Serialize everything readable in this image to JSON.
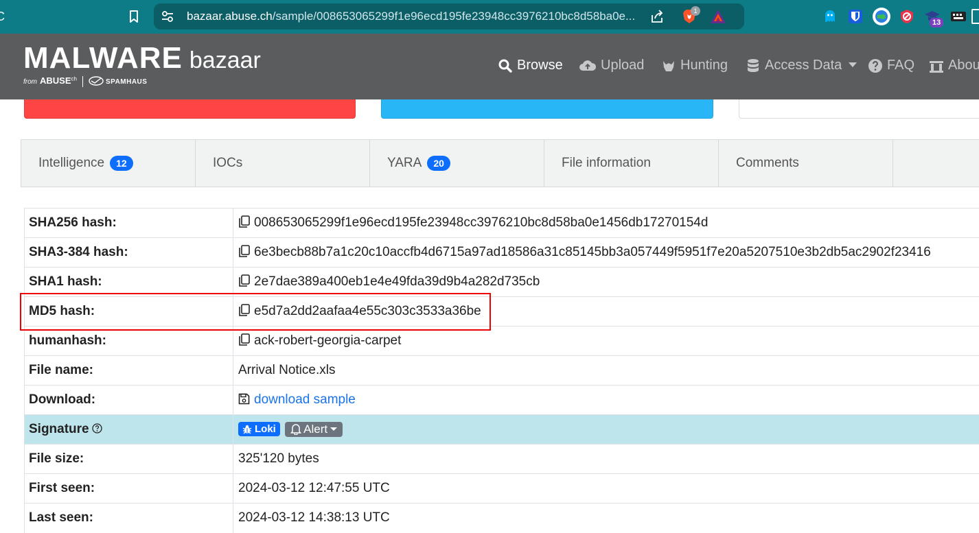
{
  "browser": {
    "url_host": "bazaar.abuse.ch",
    "url_path": "/sample/008653065299f1e96ecd195fe23948cc3976210bc8d58ba0e...",
    "brave_count": "1",
    "ext_badge_count": "13"
  },
  "header": {
    "logo_main": "MALWARE",
    "logo_suffix": "bazaar",
    "logo_from": "from",
    "logo_abuse": "ABUSE",
    "logo_ch": "ch",
    "logo_spamhaus": "SPAMHAUS",
    "nav": [
      {
        "label": "Browse",
        "icon": "search-icon",
        "active": true
      },
      {
        "label": "Upload",
        "icon": "cloud-upload-icon"
      },
      {
        "label": "Hunting",
        "icon": "hunting-icon"
      },
      {
        "label": "Access Data",
        "icon": "database-icon"
      },
      {
        "label": "FAQ",
        "icon": "question-circle-icon"
      },
      {
        "label": "Abou",
        "icon": "bank-icon"
      }
    ]
  },
  "tabs": [
    {
      "label": "Intelligence",
      "badge": "12"
    },
    {
      "label": "IOCs",
      "badge": ""
    },
    {
      "label": "YARA",
      "badge": "20"
    },
    {
      "label": "File information",
      "badge": ""
    },
    {
      "label": "Comments",
      "badge": ""
    }
  ],
  "rows": {
    "sha256": {
      "key": "SHA256 hash:",
      "value": "008653065299f1e96ecd195fe23948cc3976210bc8d58ba0e1456db17270154d"
    },
    "sha3": {
      "key": "SHA3-384 hash:",
      "value": "6e3becb88b7a1c20c10accfb4d6715a97ad18586a31c85145bb3a057449f5951f7e20a5207510e3b2db5ac2902f23416"
    },
    "sha1": {
      "key": "SHA1 hash:",
      "value": "2e7dae389a400eb1e4e49fda39d9b4a282d735cb"
    },
    "md5": {
      "key": "MD5 hash:",
      "value": "e5d7a2dd2aafaa4e55c303c3533a36be"
    },
    "humanhash": {
      "key": "humanhash:",
      "value": "ack-robert-georgia-carpet"
    },
    "filename": {
      "key": "File name:",
      "value": "Arrival Notice.xls"
    },
    "download": {
      "key": "Download:",
      "value": "download sample"
    },
    "signature": {
      "key": "Signature",
      "badge": "Loki",
      "button": "Alert"
    },
    "filesize": {
      "key": "File size:",
      "value": "325'120 bytes"
    },
    "firstseen": {
      "key": "First seen:",
      "value": "2024-03-12 12:47:55 UTC"
    },
    "lastseen": {
      "key": "Last seen:",
      "value": "2024-03-12 14:38:13 UTC"
    }
  }
}
